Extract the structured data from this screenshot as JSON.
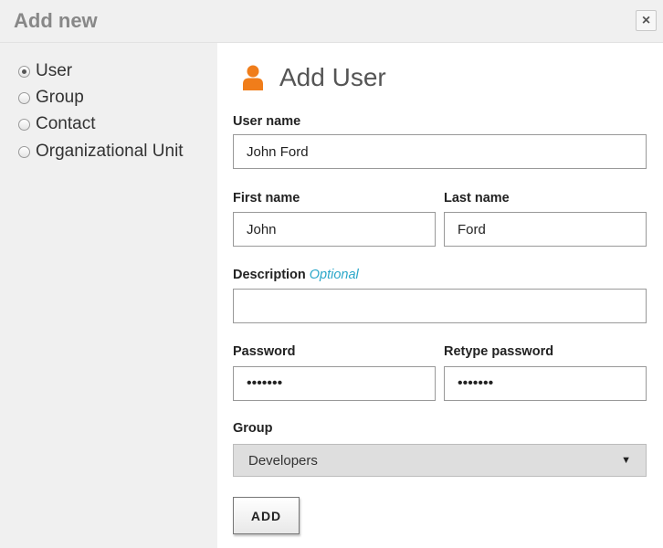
{
  "dialog": {
    "title": "Add new",
    "close_label": "×"
  },
  "sidebar": {
    "options": [
      {
        "label": "User",
        "checked": true
      },
      {
        "label": "Group",
        "checked": false
      },
      {
        "label": "Contact",
        "checked": false
      },
      {
        "label": "Organizational Unit",
        "checked": false
      }
    ]
  },
  "form": {
    "title": "Add User",
    "icon": "user-icon",
    "accent_color": "#f07d1a",
    "username": {
      "label": "User name",
      "value": "John Ford"
    },
    "first_name": {
      "label": "First name",
      "value": "John"
    },
    "last_name": {
      "label": "Last name",
      "value": "Ford"
    },
    "description": {
      "label": "Description",
      "optional": "Optional",
      "value": ""
    },
    "password": {
      "label": "Password",
      "value": "•••••••"
    },
    "retype_password": {
      "label": "Retype password",
      "value": "•••••••"
    },
    "group": {
      "label": "Group",
      "selected": "Developers"
    },
    "submit_label": "ADD"
  }
}
